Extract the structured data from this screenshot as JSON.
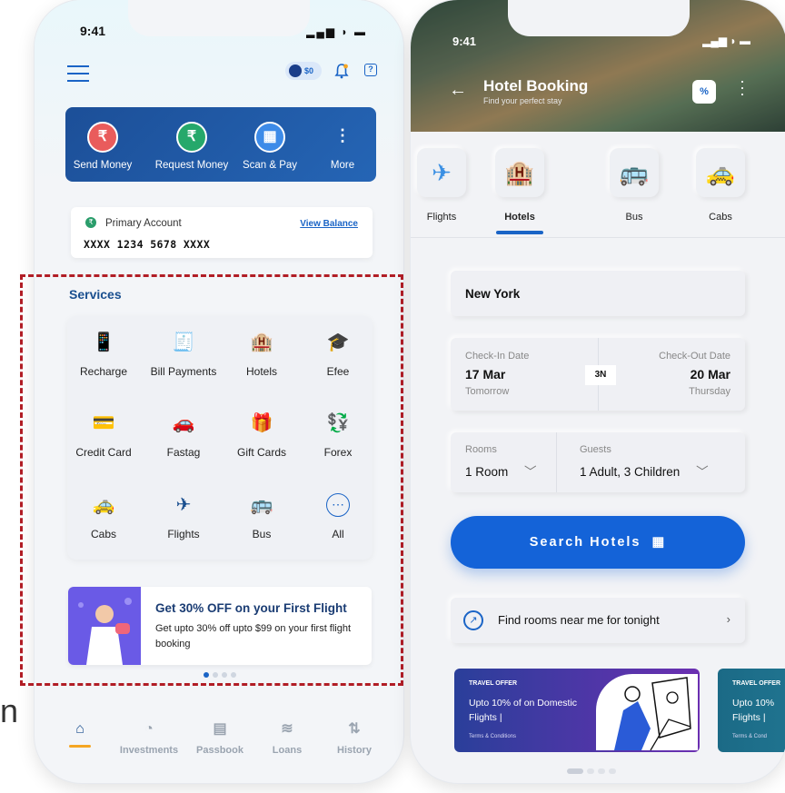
{
  "left_phone": {
    "status_time": "9:41",
    "wallet_balance": "$0",
    "help_label": "?",
    "quick_actions": [
      {
        "label": "Send Money",
        "icon": "₹",
        "color": "#e95c5c"
      },
      {
        "label": "Request Money",
        "icon": "₹",
        "color": "#26a86b"
      },
      {
        "label": "Scan & Pay",
        "icon": "▦",
        "color": "#3d8be8"
      },
      {
        "label": "More",
        "icon": "⋮",
        "color": "#1f5aa6"
      }
    ],
    "account": {
      "label": "Primary Account",
      "view_balance": "View Balance",
      "number": "XXXX 1234 5678 XXXX"
    },
    "services_title": "Services",
    "services": [
      {
        "label": "Recharge",
        "icon": "📱"
      },
      {
        "label": "Bill Payments",
        "icon": "🧾"
      },
      {
        "label": "Hotels",
        "icon": "🏨"
      },
      {
        "label": "Efee",
        "icon": "🎓"
      },
      {
        "label": "Credit Card",
        "icon": "💳"
      },
      {
        "label": "Fastag",
        "icon": "🚗"
      },
      {
        "label": "Gift Cards",
        "icon": "🎁"
      },
      {
        "label": "Forex",
        "icon": "💱"
      },
      {
        "label": "Cabs",
        "icon": "🚕"
      },
      {
        "label": "Flights",
        "icon": "✈"
      },
      {
        "label": "Bus",
        "icon": "🚌"
      },
      {
        "label": "All",
        "icon": "⋯"
      }
    ],
    "promo": {
      "title": "Get 30% OFF on your First Flight",
      "subtitle": "Get upto 30% off upto $99 on your first flight booking"
    },
    "nav": [
      {
        "label": "",
        "icon": "⌂"
      },
      {
        "label": "Investments",
        "icon": "◔"
      },
      {
        "label": "Passbook",
        "icon": "▤"
      },
      {
        "label": "Loans",
        "icon": "≋"
      },
      {
        "label": "History",
        "icon": "⇅"
      }
    ],
    "partial_letter": "n"
  },
  "right_phone": {
    "status_time": "9:41",
    "title": "Hotel Booking",
    "subtitle": "Find your perfect stay",
    "offer_badge": "%",
    "categories": [
      {
        "label": "Flights",
        "icon": "✈"
      },
      {
        "label": "Hotels",
        "icon": "🏨"
      },
      {
        "label": "Bus",
        "icon": "🚌"
      },
      {
        "label": "Cabs",
        "icon": "🚕"
      }
    ],
    "city": "New York",
    "checkin_label": "Check-In Date",
    "checkin_date": "17 Mar",
    "checkin_day": "Tomorrow",
    "nights": "3N",
    "checkout_label": "Check-Out Date",
    "checkout_date": "20 Mar",
    "checkout_day": "Thursday",
    "rooms_label": "Rooms",
    "rooms_value": "1 Room",
    "guests_label": "Guests",
    "guests_value": "1 Adult, 3 Children",
    "search_button": "Search Hotels",
    "nearby_text": "Find rooms near me for tonight",
    "offers": [
      {
        "tag": "TRAVEL OFFER",
        "text": "Upto 10% of on Domestic Flights |",
        "terms": "Terms & Conditions"
      },
      {
        "tag": "TRAVEL OFFER",
        "text": "Upto 10% Flights |",
        "terms": "Terms & Cond"
      }
    ]
  }
}
